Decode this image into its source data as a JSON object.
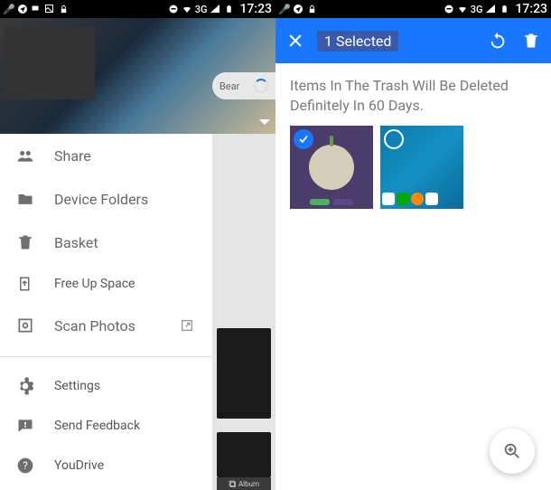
{
  "statusbar": {
    "network": "3G",
    "time": "17:23"
  },
  "left": {
    "peek_label": "Bear",
    "menu": {
      "share": "Share",
      "device_folders": "Device Folders",
      "basket": "Basket",
      "free_up_space": "Free Up Space",
      "scan_photos": "Scan Photos",
      "settings": "Settings",
      "send_feedback": "Send Feedback",
      "you_drive": "YouDrive"
    },
    "bg_chip": "Album"
  },
  "right": {
    "selection_title": "1 Selected",
    "trash_line1": "Items In The Trash Will Be Deleted",
    "trash_line2": "Definitely In 60 Days."
  }
}
